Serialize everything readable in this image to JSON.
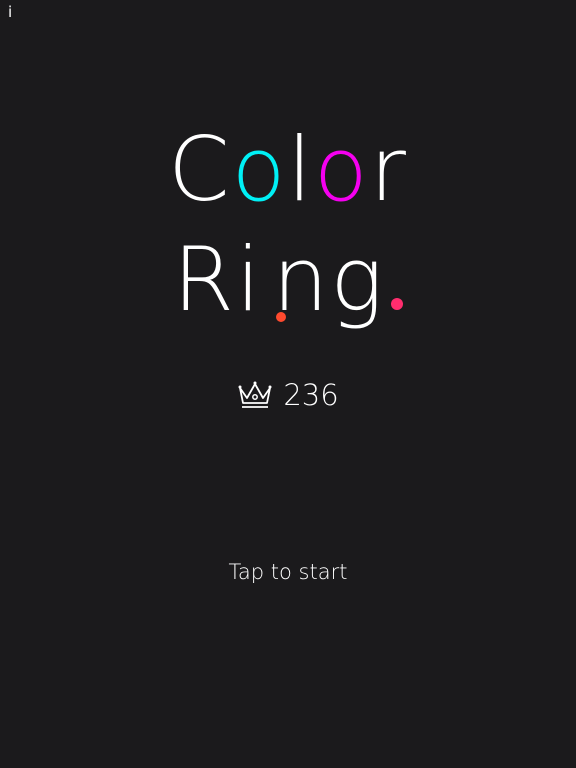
{
  "info_button": {
    "label": "i"
  },
  "title": {
    "line1": [
      {
        "char": "C",
        "color": "#ffffff"
      },
      {
        "char": "o",
        "color": "#00f0f5"
      },
      {
        "char": "l",
        "color": "#ffffff"
      },
      {
        "char": "o",
        "color": "#f500f0"
      },
      {
        "char": "r",
        "color": "#ffffff"
      }
    ],
    "line2": {
      "r_char": "R",
      "i_char": "i",
      "i_dot_color": "#ff4a2e",
      "rest": "ng",
      "period_color": "#ff2d6e"
    }
  },
  "best_score": {
    "icon": "crown-icon",
    "value": "236"
  },
  "prompt": {
    "label": "Tap to start"
  },
  "colors": {
    "background": "#1b1a1c",
    "cyan": "#00f0f5",
    "magenta": "#f500f0",
    "orange_red": "#ff4a2e",
    "pink_red": "#ff2d6e"
  }
}
